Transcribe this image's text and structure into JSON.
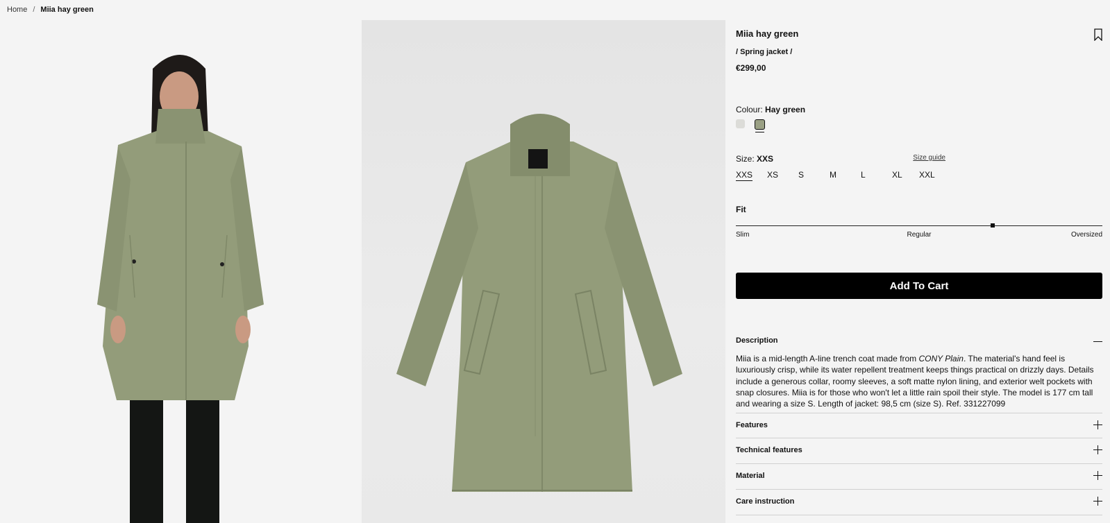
{
  "breadcrumb": {
    "home": "Home",
    "separator": "/",
    "current": "Miia hay green"
  },
  "product": {
    "title": "Miia hay green",
    "category": "/ Spring jacket /",
    "price": "€299,00"
  },
  "colour": {
    "label": "Colour:",
    "selected": "Hay green",
    "swatches": [
      {
        "name": "light-grey",
        "color": "#dcdcd8"
      },
      {
        "name": "hay-green",
        "color": "#9aa084",
        "selected": true
      }
    ]
  },
  "size": {
    "label": "Size:",
    "selected": "XXS",
    "guide_label": "Size guide",
    "options": [
      "XXS",
      "XS",
      "S",
      "M",
      "L",
      "XL",
      "XXL"
    ]
  },
  "fit": {
    "title": "Fit",
    "labels": [
      "Slim",
      "Regular",
      "Oversized"
    ],
    "level": 0.7
  },
  "cart": {
    "button_label": "Add To Cart"
  },
  "description": {
    "heading": "Description",
    "text_before": "Miia is a mid-length A-line trench coat made from ",
    "text_emphasis": "CONY Plain",
    "text_after": ". The material's hand feel is luxuriously crisp, while its water repellent treatment keeps things practical on drizzly days. Details include a generous collar, roomy sleeves, a soft matte nylon lining, and exterior welt pockets with snap closures. Miia is for those who won't let a little rain spoil their style. The model is 177 cm tall and wearing a size S. Length of jacket: 98,5 cm (size S). Ref. 331227099"
  },
  "accordions": [
    "Features",
    "Technical features",
    "Material",
    "Care instruction"
  ],
  "colors": {
    "coat": "#939c7a",
    "coat_shadow": "#7f8868",
    "trousers": "#141614",
    "accent": "#000000"
  }
}
